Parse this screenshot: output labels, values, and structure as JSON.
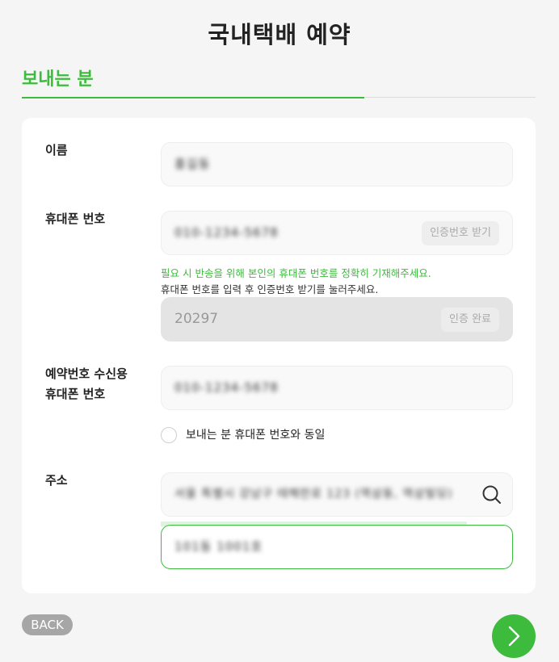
{
  "header": {
    "title": "국내택배 예약"
  },
  "section": {
    "title": "보내는 분"
  },
  "form": {
    "name": {
      "label": "이름",
      "value": "홍길동"
    },
    "phone": {
      "label": "휴대폰 번호",
      "value": "010-1234-5678",
      "request_button": "인증번호 받기",
      "notice_green": "필요 시 반송을 위해 본인의 휴대폰 번호를 정확히 기재해주세요.",
      "notice_gray": "휴대폰 번호를 입력 후 인증번호 받기를 눌러주세요."
    },
    "verification": {
      "value": "20297",
      "status_button": "인증 완료"
    },
    "reservation_phone": {
      "label_line1": "예약번호 수신용",
      "label_line2": "휴대폰 번호",
      "value": "010-1234-5678",
      "same_checkbox_label": "보내는 분 휴대폰 번호와 동일",
      "same_checked": false
    },
    "address": {
      "label": "주소",
      "value": "서울 특별시 강남구 테헤란로 123 (역삼동, 역삼빌딩)",
      "detail_value": "101동 1001호",
      "icon": "search-icon",
      "scroll_progress": 0.87
    }
  },
  "footer": {
    "back_label": "BACK",
    "next_icon": "chevron-right-icon"
  },
  "colors": {
    "accent": "#3dbb3d",
    "background": "#f5f5f5",
    "card": "#ffffff"
  }
}
